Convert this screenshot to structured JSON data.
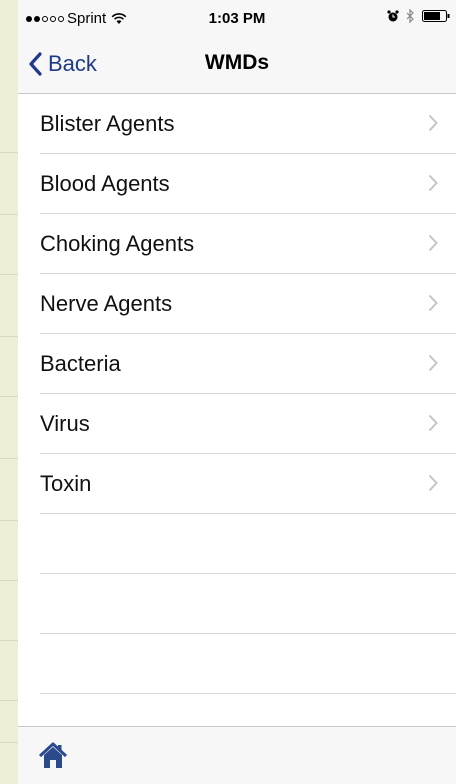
{
  "status_bar": {
    "signal_bars_filled": 2,
    "signal_bars_total": 5,
    "carrier": "Sprint",
    "time": "1:03 PM",
    "icons": [
      "wifi-icon",
      "alarm-icon",
      "bluetooth-icon",
      "battery-icon"
    ],
    "battery_level": 0.75
  },
  "nav": {
    "back_label": "Back",
    "title": "WMDs",
    "accent_color": "#1e3a8a"
  },
  "list": {
    "items": [
      {
        "label": "Blister Agents"
      },
      {
        "label": "Blood Agents"
      },
      {
        "label": "Choking Agents"
      },
      {
        "label": "Nerve Agents"
      },
      {
        "label": "Bacteria"
      },
      {
        "label": "Virus"
      },
      {
        "label": "Toxin"
      }
    ]
  },
  "toolbar": {
    "home_icon": "home-icon",
    "home_color": "#2b4a8b"
  }
}
